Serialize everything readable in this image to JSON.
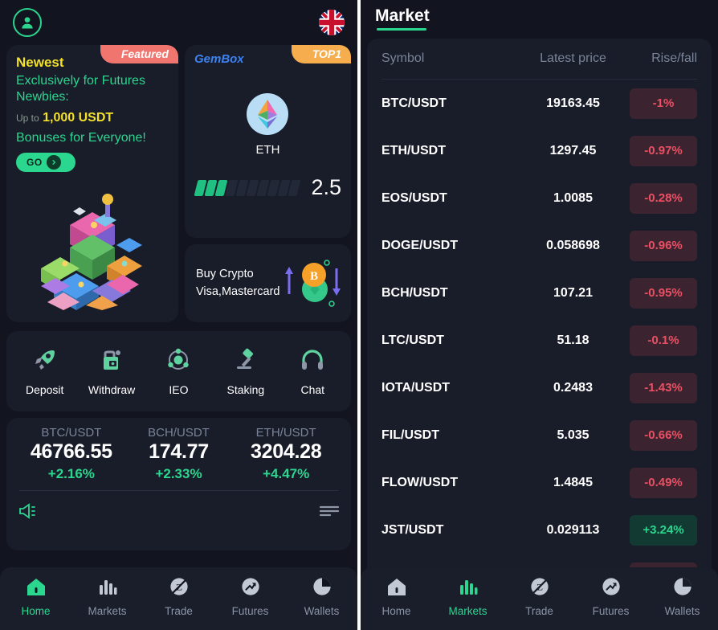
{
  "left": {
    "topbar": {
      "avatar_icon": "user-avatar-icon",
      "language_icon": "uk-flag-icon"
    },
    "featured_card": {
      "ribbon": "Featured",
      "title": "Newest",
      "line1": "Exclusively for Futures",
      "line2": "Newbies:",
      "upto_label": "Up to",
      "amount": "1,000 USDT",
      "bonus": "Bonuses for Everyone!",
      "cta": "GO",
      "illustration_icon": "isometric-city-illustration"
    },
    "gembox_card": {
      "ribbon": "TOP1",
      "title": "GemBox",
      "symbol": "ETH",
      "coin_icon": "ethereum-icon",
      "score": "2.5",
      "bars_total": 10,
      "bars_filled": 3
    },
    "buy_card": {
      "line1": "Buy Crypto",
      "line2": "Visa,Mastercard",
      "icons": [
        "up-arrow-icon",
        "bitcoin-icon",
        "usdt-icon",
        "down-arrow-icon"
      ]
    },
    "quick_actions": [
      {
        "label": "Deposit",
        "icon": "rocket-icon"
      },
      {
        "label": "Withdraw",
        "icon": "safe-box-icon"
      },
      {
        "label": "IEO",
        "icon": "atom-icon"
      },
      {
        "label": "Staking",
        "icon": "gavel-icon"
      },
      {
        "label": "Chat",
        "icon": "headset-icon"
      }
    ],
    "tickers": [
      {
        "pair": "BTC/USDT",
        "price": "46766.55",
        "change": "+2.16%"
      },
      {
        "pair": "BCH/USDT",
        "price": "174.77",
        "change": "+2.33%"
      },
      {
        "pair": "ETH/USDT",
        "price": "3204.28",
        "change": "+4.47%"
      }
    ],
    "notice": {
      "megaphone_icon": "megaphone-icon",
      "list_icon": "list-lines-icon"
    }
  },
  "right": {
    "title": "Market",
    "columns": {
      "symbol": "Symbol",
      "price": "Latest price",
      "change": "Rise/fall"
    },
    "rows": [
      {
        "symbol": "BTC/USDT",
        "price": "19163.45",
        "change": "-1%",
        "dir": "down"
      },
      {
        "symbol": "ETH/USDT",
        "price": "1297.45",
        "change": "-0.97%",
        "dir": "down"
      },
      {
        "symbol": "EOS/USDT",
        "price": "1.0085",
        "change": "-0.28%",
        "dir": "down"
      },
      {
        "symbol": "DOGE/USDT",
        "price": "0.058698",
        "change": "-0.96%",
        "dir": "down"
      },
      {
        "symbol": "BCH/USDT",
        "price": "107.21",
        "change": "-0.95%",
        "dir": "down"
      },
      {
        "symbol": "LTC/USDT",
        "price": "51.18",
        "change": "-0.1%",
        "dir": "down"
      },
      {
        "symbol": "IOTA/USDT",
        "price": "0.2483",
        "change": "-1.43%",
        "dir": "down"
      },
      {
        "symbol": "FIL/USDT",
        "price": "5.035",
        "change": "-0.66%",
        "dir": "down"
      },
      {
        "symbol": "FLOW/USDT",
        "price": "1.4845",
        "change": "-0.49%",
        "dir": "down"
      },
      {
        "symbol": "JST/USDT",
        "price": "0.029113",
        "change": "+3.24%",
        "dir": "up"
      }
    ]
  },
  "bottom_nav": [
    {
      "label": "Home",
      "icon": "home-icon"
    },
    {
      "label": "Markets",
      "icon": "bars-chart-icon"
    },
    {
      "label": "Trade",
      "icon": "trade-circle-icon"
    },
    {
      "label": "Futures",
      "icon": "futures-arrow-icon"
    },
    {
      "label": "Wallets",
      "icon": "wallet-pie-icon"
    }
  ],
  "colors": {
    "accent_green": "#2bd68f",
    "down_red": "#ec4f63",
    "panel_bg": "#12141f",
    "card_bg": "#191c29",
    "yellow": "#f2e02a",
    "featured_ribbon": "#f0756e",
    "top1_ribbon": "#f5ad4e"
  }
}
